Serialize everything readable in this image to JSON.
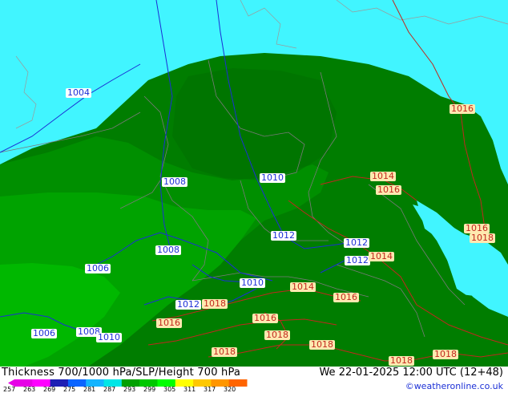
{
  "map": {
    "colors": {
      "sea": "#41f5ff",
      "dark_green": "#007d00",
      "mid_green": "#008f00",
      "light_green": "#00b100",
      "bright_green": "#00c800",
      "isobar_blue": "#1b2fd6",
      "isobar_red": "#c0281e",
      "border": "#7a7a7a"
    },
    "labels": [
      {
        "text": "1004",
        "color": "blue"
      },
      {
        "text": "1016",
        "color": "red"
      },
      {
        "text": "1008",
        "color": "blue"
      },
      {
        "text": "1010",
        "color": "blue"
      },
      {
        "text": "1014",
        "color": "red"
      },
      {
        "text": "1016",
        "color": "red"
      },
      {
        "text": "1016",
        "color": "red"
      },
      {
        "text": "1018",
        "color": "red"
      },
      {
        "text": "1012",
        "color": "blue"
      },
      {
        "text": "1012",
        "color": "blue"
      },
      {
        "text": "1012",
        "color": "blue"
      },
      {
        "text": "1014",
        "color": "red"
      },
      {
        "text": "1008",
        "color": "blue"
      },
      {
        "text": "1006",
        "color": "blue"
      },
      {
        "text": "1010",
        "color": "blue"
      },
      {
        "text": "1014",
        "color": "red"
      },
      {
        "text": "1016",
        "color": "red"
      },
      {
        "text": "1012",
        "color": "blue"
      },
      {
        "text": "1018",
        "color": "red"
      },
      {
        "text": "1016",
        "color": "red"
      },
      {
        "text": "1016",
        "color": "red"
      },
      {
        "text": "1006",
        "color": "blue"
      },
      {
        "text": "1008",
        "color": "blue"
      },
      {
        "text": "1010",
        "color": "blue"
      },
      {
        "text": "1018",
        "color": "red"
      },
      {
        "text": "1018",
        "color": "red"
      },
      {
        "text": "1018",
        "color": "red"
      },
      {
        "text": "1018",
        "color": "red"
      },
      {
        "text": "1018",
        "color": "red"
      }
    ]
  },
  "footer": {
    "title": "Thickness 700/1000 hPa/SLP/Height 700 hPa",
    "datetime": "We 22-01-2025 12:00 UTC (12+48)",
    "credit": "©weatheronline.co.uk",
    "scale_ticks": [
      "257",
      "263",
      "269",
      "275",
      "281",
      "287",
      "293",
      "299",
      "305",
      "311",
      "317",
      "320"
    ],
    "scale_colors": [
      "#e600e6",
      "#ff00ff",
      "#1e1eb4",
      "#0a64ff",
      "#14b4ff",
      "#00e6e6",
      "#00a000",
      "#00c800",
      "#00ff00",
      "#ffff00",
      "#ffc800",
      "#ff9600",
      "#ff6400"
    ]
  }
}
